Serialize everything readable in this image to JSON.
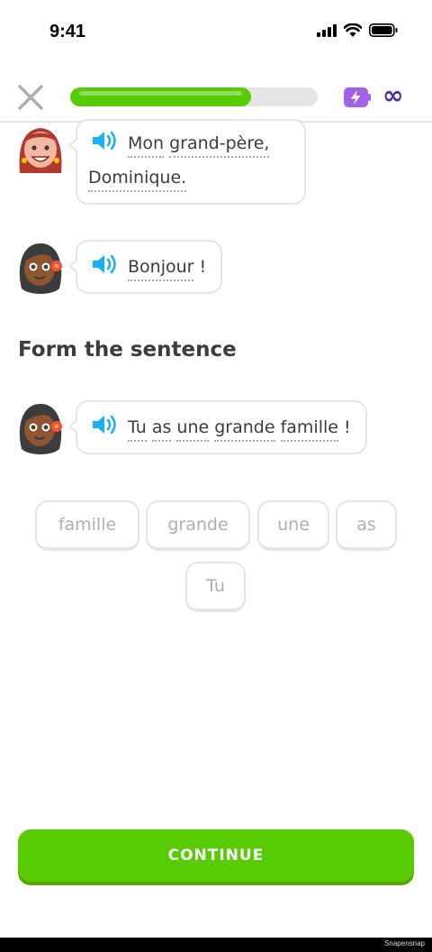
{
  "status_bar": {
    "time": "9:41"
  },
  "header": {
    "progress_percent": 73,
    "energy_value": "∞",
    "colors": {
      "progress": "#58cc02",
      "energy": "#a560e8",
      "infinity": "#4b2ca8"
    }
  },
  "messages": [
    {
      "speaker_avatar": "woman-red-hair-avatar",
      "words": [
        "Mon",
        "grand-père,",
        "Dominique."
      ]
    },
    {
      "speaker_avatar": "woman-dark-hair-flower-avatar",
      "words": [
        "Bonjour",
        "!"
      ]
    }
  ],
  "section_title": "Form the sentence",
  "prompt": {
    "speaker_avatar": "woman-dark-hair-flower-avatar",
    "words": [
      "Tu",
      "as",
      "une",
      "grande",
      "famille",
      "!"
    ]
  },
  "word_bank": [
    "famille",
    "grande",
    "une",
    "as",
    "Tu"
  ],
  "continue_label": "CONTINUE",
  "watermark": "Snapensnap"
}
